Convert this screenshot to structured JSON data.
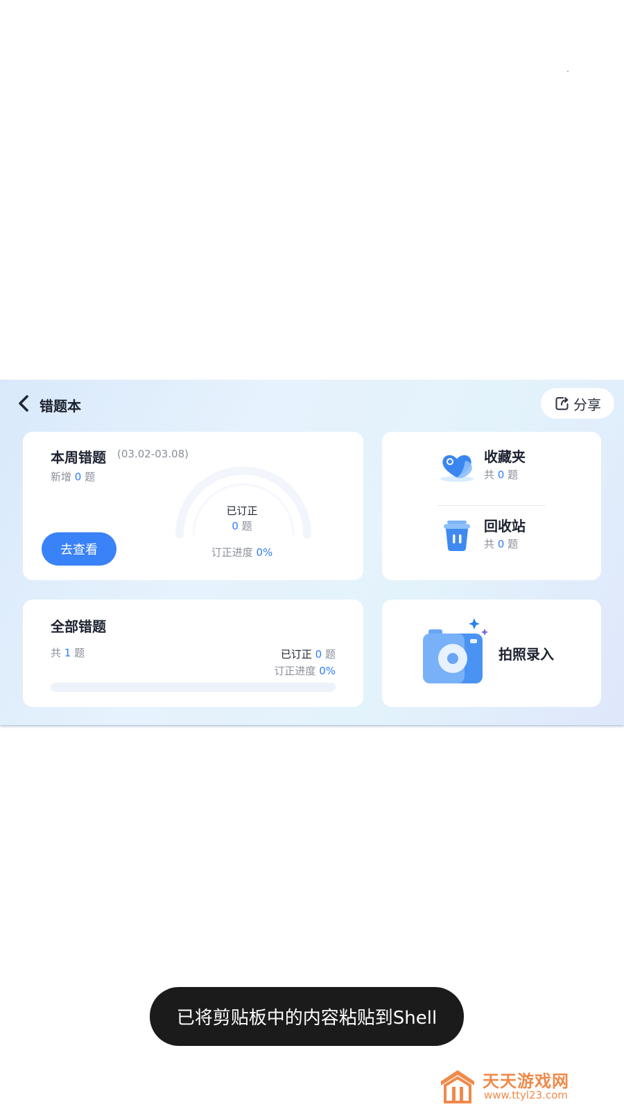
{
  "header": {
    "title": "错题本",
    "share_label": "分享"
  },
  "weekly": {
    "title": "本周错题",
    "date_range": "(03.02-03.08)",
    "new_prefix": "新增",
    "new_count": "0",
    "question_unit": "题",
    "view_button": "去查看",
    "corrected_label": "已订正",
    "corrected_count": "0",
    "progress_label": "订正进度",
    "progress_value": "0%"
  },
  "folders": {
    "favorites": {
      "name": "收藏夹",
      "prefix": "共",
      "count": "0",
      "unit": "题"
    },
    "recycle": {
      "name": "回收站",
      "prefix": "共",
      "count": "0",
      "unit": "题"
    }
  },
  "all_mistakes": {
    "title": "全部错题",
    "prefix": "共",
    "count": "1",
    "unit": "题",
    "corrected_label": "已订正",
    "corrected_count": "0",
    "progress_label": "订正进度",
    "progress_value": "0%",
    "progress_fraction": 0
  },
  "photo_entry": {
    "label": "拍照录入"
  },
  "toast": {
    "message": "已将剪贴板中的内容粘贴到Shell"
  },
  "watermark": {
    "name": "天天游戏网",
    "url": "www.ttyl23.com"
  },
  "icons": {
    "back": "chevron-left-icon",
    "share": "share-icon",
    "favorites": "heart-folder-icon",
    "recycle": "trash-icon",
    "camera": "camera-icon",
    "watermark_logo": "house-logo-icon"
  },
  "colors": {
    "accent": "#3a82f7",
    "number": "#2f7bf5",
    "muted_text": "#8a8f99",
    "toast_bg": "#1b1b1b",
    "watermark": "#f0894a"
  }
}
